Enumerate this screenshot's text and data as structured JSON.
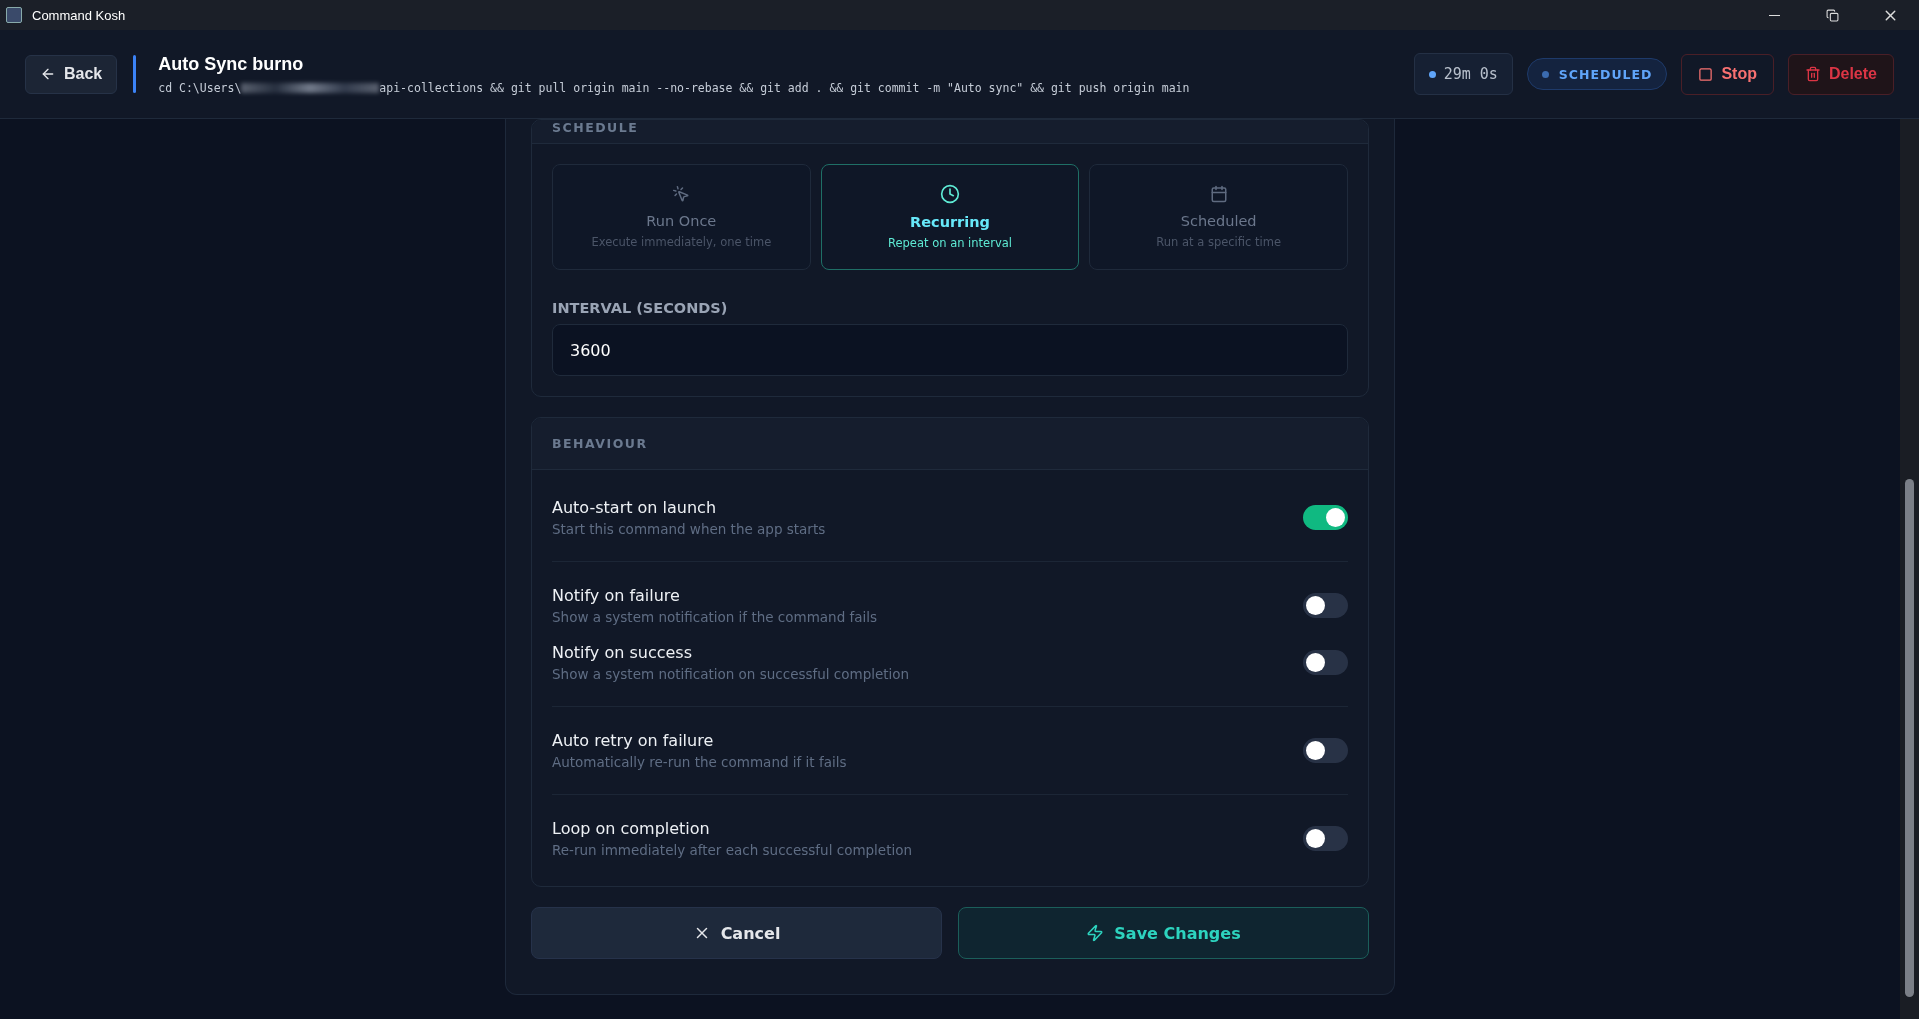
{
  "window": {
    "title": "Command Kosh"
  },
  "header": {
    "back_label": "Back",
    "title": "Auto Sync burno",
    "command_prefix": "cd C:\\Users\\",
    "command_rest": "api-collections && git pull origin main --no-rebase && git add . && git commit -m \"Auto sync\" && git push origin main",
    "timer": "29m 0s",
    "status": "SCHEDULED",
    "stop_label": "Stop",
    "delete_label": "Delete"
  },
  "schedule": {
    "heading": "SCHEDULE",
    "modes": [
      {
        "kind": "once",
        "title": "Run Once",
        "subtitle": "Execute immediately, one time",
        "selected": false
      },
      {
        "kind": "recurring",
        "title": "Recurring",
        "subtitle": "Repeat on an interval",
        "selected": true
      },
      {
        "kind": "scheduled",
        "title": "Scheduled",
        "subtitle": "Run at a specific time",
        "selected": false
      }
    ],
    "interval_label": "INTERVAL (SECONDS)",
    "interval_value": "3600"
  },
  "behaviour": {
    "heading": "BEHAVIOUR",
    "groups": [
      {
        "items": [
          {
            "title": "Auto-start on launch",
            "description": "Start this command when the app starts",
            "on": true
          }
        ]
      },
      {
        "items": [
          {
            "title": "Notify on failure",
            "description": "Show a system notification if the command fails",
            "on": false
          },
          {
            "title": "Notify on success",
            "description": "Show a system notification on successful completion",
            "on": false
          }
        ]
      },
      {
        "items": [
          {
            "title": "Auto retry on failure",
            "description": "Automatically re-run the command if it fails",
            "on": false
          }
        ]
      },
      {
        "items": [
          {
            "title": "Loop on completion",
            "description": "Re-run immediately after each successful completion",
            "on": false
          }
        ]
      }
    ]
  },
  "actions": {
    "cancel_label": "Cancel",
    "save_label": "Save Changes"
  }
}
